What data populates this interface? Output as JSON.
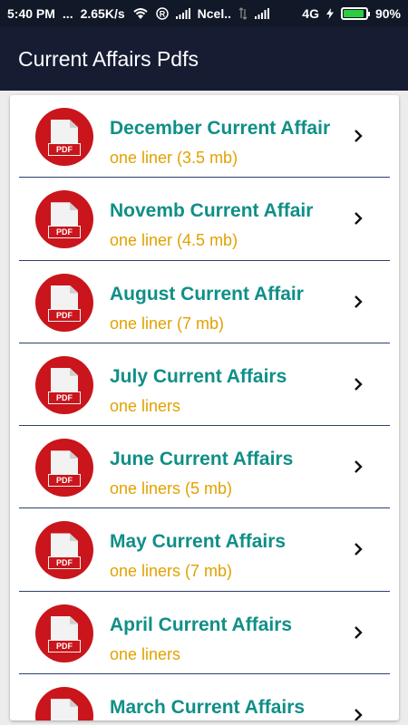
{
  "status_bar": {
    "time": "5:40 PM",
    "dots": "...",
    "speed": "2.65K/s",
    "carrier": "Ncel..",
    "network": "4G",
    "battery": "90%",
    "battery_level": 0.9,
    "icons": [
      "wifi-icon",
      "registered-icon",
      "signal-icon",
      "data-arrows-icon",
      "signal-icon",
      "charging-bolt-icon",
      "battery-icon"
    ]
  },
  "app_bar": {
    "title": "Current Affairs Pdfs"
  },
  "items": [
    {
      "title": "December Current Affair",
      "subtitle": "one liner (3.5 mb)"
    },
    {
      "title": "Novemb Current Affair",
      "subtitle": "one liner (4.5 mb)"
    },
    {
      "title": "August Current Affair",
      "subtitle": "one liner (7 mb)"
    },
    {
      "title": "July Current Affairs",
      "subtitle": "one liners"
    },
    {
      "title": "June Current Affairs",
      "subtitle": "one liners (5 mb)"
    },
    {
      "title": "May Current Affairs",
      "subtitle": "one liners (7 mb)"
    },
    {
      "title": "April Current Affairs",
      "subtitle": "one liners"
    },
    {
      "title": "March Current Affairs",
      "subtitle": ""
    }
  ],
  "pdf_label": "PDF",
  "colors": {
    "app_bar": "#161d33",
    "status_bar": "#111827",
    "title": "#0f8f87",
    "subtitle": "#e1a200",
    "pdf_red": "#c9151b",
    "divider": "#2f3f6e"
  }
}
